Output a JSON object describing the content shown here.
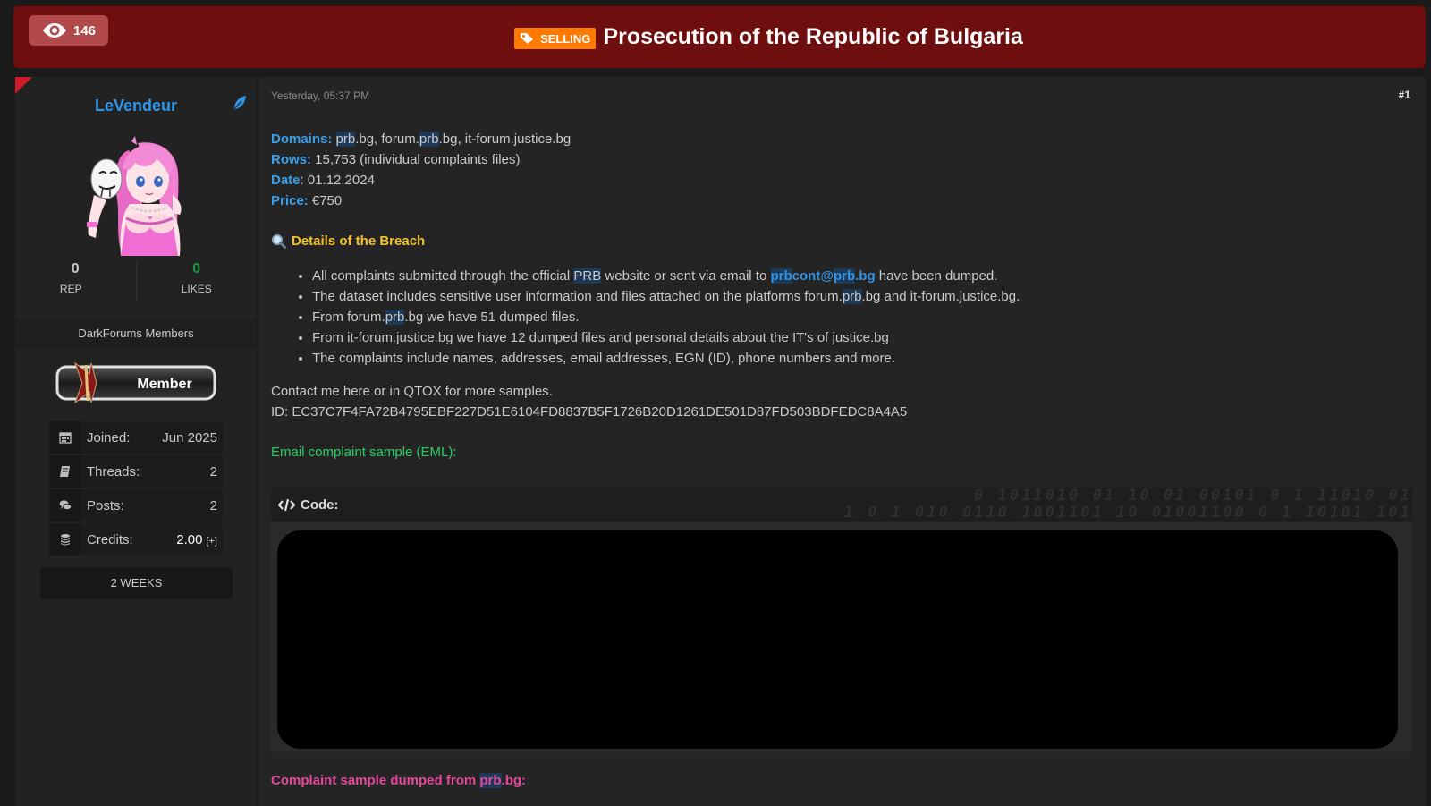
{
  "header": {
    "views": "146",
    "prefix": "SELLING",
    "title": "Prosecution of the Republic of Bulgaria"
  },
  "sidebar": {
    "username": "LeVendeur",
    "rep_value": "0",
    "rep_label": "REP",
    "likes_value": "0",
    "likes_label": "LIKES",
    "group": "DarkForums Members",
    "badge_label": "Member",
    "info": [
      {
        "label": "Joined:",
        "value": "Jun 2025",
        "icon": "calendar-icon"
      },
      {
        "label": "Threads:",
        "value": "2",
        "icon": "book-icon"
      },
      {
        "label": "Posts:",
        "value": "2",
        "icon": "comments-icon"
      },
      {
        "label": "Credits:",
        "value": "2.00",
        "extra": "[+]",
        "icon": "coins-icon"
      }
    ],
    "weeks": "2 WEEKS"
  },
  "post": {
    "date": "Yesterday, 05:37 PM",
    "number": "#1",
    "domains_label": "Domains:",
    "domains_parts": [
      "prb",
      ".bg, forum.",
      "prb",
      ".bg, it-forum.justice.bg"
    ],
    "rows_label": "Rows:",
    "rows_value": "15,753 (individual complaints files)",
    "date_label": "Date",
    "date_value": ": 01.12.2024",
    "price_label": "Price:",
    "price_value": "€750",
    "details_title": "Details of the Breach",
    "bullet1": [
      "All complaints submitted through the official ",
      "PRB",
      " website or sent via email to ",
      "prbcont@prb.bg",
      " have been dumped."
    ],
    "bullet2": [
      "The dataset includes sensitive user information and files attached on the platforms forum.",
      "prb",
      ".bg and it-forum.justice.bg."
    ],
    "bullet3": [
      "From forum.",
      "prb",
      ".bg we have 51 dumped files."
    ],
    "bullet4": "From it-forum.justice.bg we have 12 dumped files and personal details about the IT's of justice.bg",
    "bullet5": "The complaints include names, addresses, email addresses, EGN (ID), phone numbers and more.",
    "contact_line1": "Contact me here or in QTOX for more samples.",
    "contact_line2": "ID: EC37C7F4FA72B4795EBF227D51E6104FD8837B5F1726B20D1261DE501D87FD503BDFEDC8A4A5",
    "eml_sample": "Email complaint sample (EML):",
    "code_label": "Code:",
    "binary_top": "0 1011010 01 10 01 00101 0 1 11010 01",
    "binary_bottom": "1 0 1 010 0110 1001101 10 01001100 0 1 10101 101",
    "pink_prefix": "Complaint sample dumped from ",
    "pink_hl": "prb",
    "pink_suffix": ".bg:"
  }
}
